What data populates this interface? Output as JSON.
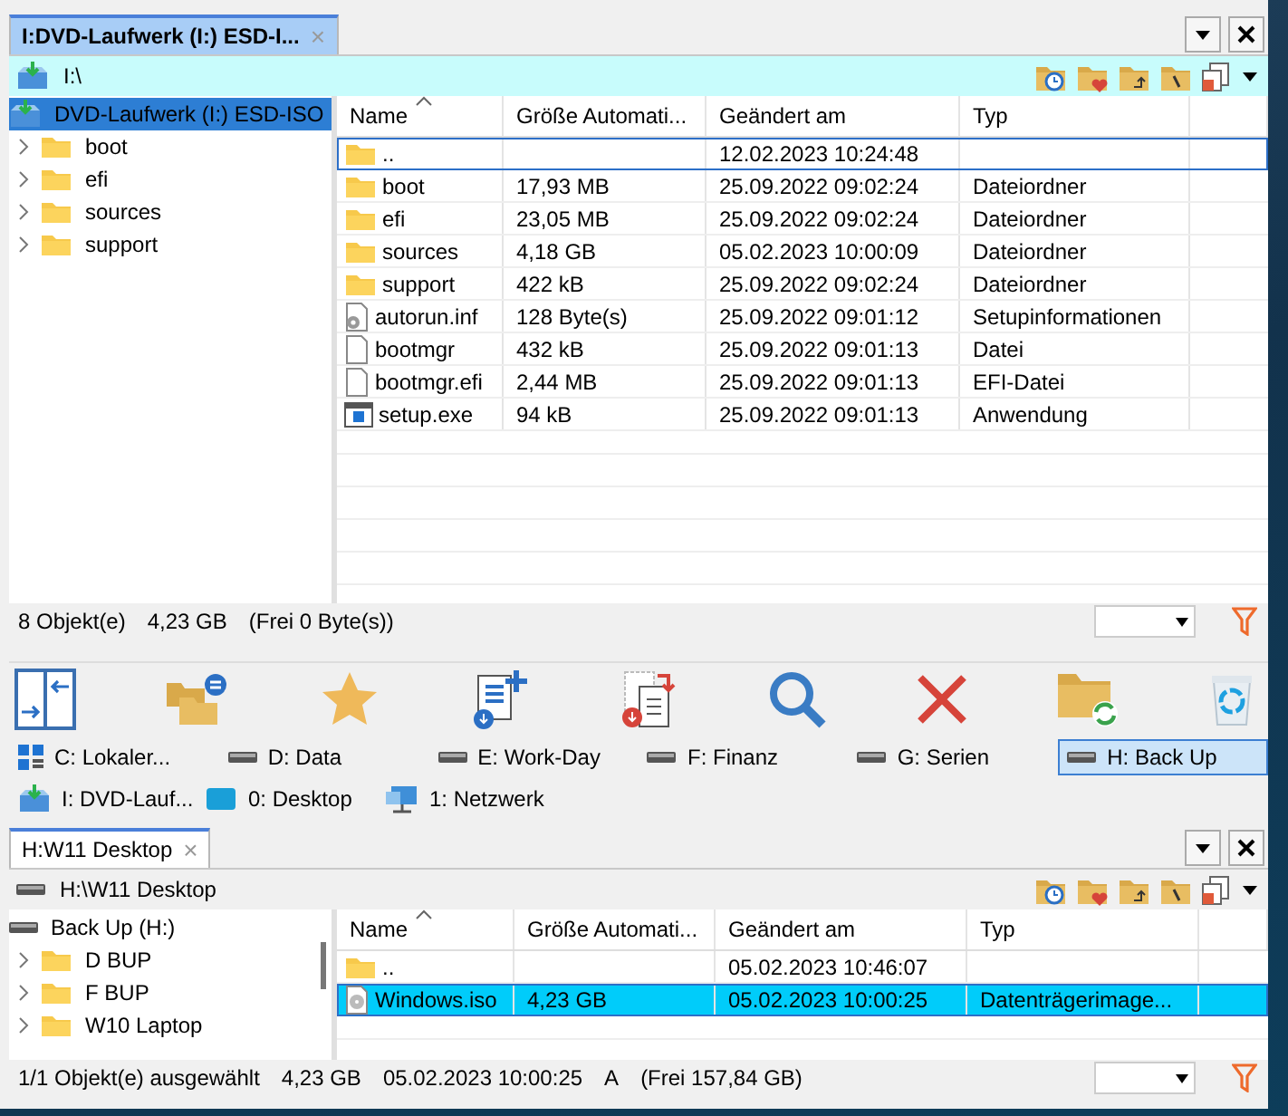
{
  "top_pane": {
    "active": true,
    "tab": {
      "label": "I:DVD-Laufwerk (I:) ESD-I...",
      "close": "×"
    },
    "path": "I:\\",
    "tree": [
      {
        "label": "DVD-Laufwerk (I:) ESD-ISO",
        "kind": "dvd",
        "selected": true,
        "children": [
          {
            "label": "boot",
            "kind": "folder",
            "selected": false
          },
          {
            "label": "efi",
            "kind": "folder",
            "selected": false
          },
          {
            "label": "sources",
            "kind": "folder",
            "selected": false
          },
          {
            "label": "support",
            "kind": "folder",
            "selected": false
          }
        ]
      }
    ],
    "columns": [
      {
        "label": "Name",
        "sorted": true
      },
      {
        "label": "Größe Automati...",
        "sorted": false
      },
      {
        "label": "Geändert am",
        "sorted": false
      },
      {
        "label": "Typ",
        "sorted": false
      }
    ],
    "rows": [
      {
        "name": "..",
        "kind": "folder",
        "modified": "12.02.2023 10:24:48",
        "selected": false,
        "focused": true
      },
      {
        "name": "boot",
        "kind": "folder",
        "size": "17,93 MB",
        "modified": "25.09.2022 09:02:24",
        "type": "Dateiordner",
        "selected": false,
        "focused": false
      },
      {
        "name": "efi",
        "kind": "folder",
        "size": "23,05 MB",
        "modified": "25.09.2022 09:02:24",
        "type": "Dateiordner",
        "selected": false,
        "focused": false
      },
      {
        "name": "sources",
        "kind": "folder",
        "size": "4,18 GB",
        "modified": "05.02.2023 10:00:09",
        "type": "Dateiordner",
        "selected": false,
        "focused": false
      },
      {
        "name": "support",
        "kind": "folder",
        "size": "422 kB",
        "modified": "25.09.2022 09:02:24",
        "type": "Dateiordner",
        "selected": false,
        "focused": false
      },
      {
        "name": "autorun.inf",
        "kind": "settings",
        "size": "128 Byte(s)",
        "modified": "25.09.2022 09:01:12",
        "type": "Setupinformationen",
        "selected": false,
        "focused": false
      },
      {
        "name": "bootmgr",
        "kind": "file",
        "size": "432 kB",
        "modified": "25.09.2022 09:01:13",
        "type": "Datei",
        "selected": false,
        "focused": false
      },
      {
        "name": "bootmgr.efi",
        "kind": "file",
        "size": "2,44 MB",
        "modified": "25.09.2022 09:01:13",
        "type": "EFI-Datei",
        "selected": false,
        "focused": false
      },
      {
        "name": "setup.exe",
        "kind": "app",
        "size": "94 kB",
        "modified": "25.09.2022 09:01:13",
        "type": "Anwendung",
        "selected": false,
        "focused": false
      }
    ],
    "status": [
      "8 Objekt(e)",
      "4,23 GB",
      "(Frei 0 Byte(s))"
    ]
  },
  "drive_bar": [
    [
      {
        "label": "C: Lokaler...",
        "kind": "system",
        "selected": false
      },
      {
        "label": "D: Data",
        "kind": "drive",
        "selected": false
      },
      {
        "label": "E: Work-Day",
        "kind": "drive",
        "selected": false
      },
      {
        "label": "F: Finanz",
        "kind": "drive",
        "selected": false
      },
      {
        "label": "G: Serien",
        "kind": "drive",
        "selected": false
      },
      {
        "label": "H: Back Up",
        "kind": "drive",
        "selected": true
      }
    ],
    [
      {
        "label": "I: DVD-Lauf...",
        "kind": "dvd",
        "selected": false
      },
      {
        "label": "0: Desktop",
        "kind": "desktop",
        "selected": false
      },
      {
        "label": "1: Netzwerk",
        "kind": "network",
        "selected": false
      }
    ]
  ],
  "bottom_pane": {
    "active": false,
    "tab": {
      "label": "H:W11 Desktop",
      "close": "×"
    },
    "path": "H:\\W11 Desktop",
    "tree": [
      {
        "label": "Back Up (H:)",
        "kind": "drive",
        "selected": false,
        "children": [
          {
            "label": "D BUP",
            "kind": "folder",
            "selected": false
          },
          {
            "label": "F BUP",
            "kind": "folder",
            "selected": false
          },
          {
            "label": "W10 Laptop",
            "kind": "folder",
            "selected": false
          }
        ]
      }
    ],
    "columns": [
      {
        "label": "Name",
        "sorted": true
      },
      {
        "label": "Größe Automati...",
        "sorted": false
      },
      {
        "label": "Geändert am",
        "sorted": false
      },
      {
        "label": "Typ",
        "sorted": false
      }
    ],
    "rows": [
      {
        "name": "..",
        "kind": "folder",
        "modified": "05.02.2023 10:46:07",
        "selected": false,
        "focused": false
      },
      {
        "name": "Windows.iso",
        "kind": "disc",
        "size": "4,23 GB",
        "modified": "05.02.2023 10:00:25",
        "type": "Datenträgerimage...",
        "selected": true,
        "focused": true
      }
    ],
    "status": [
      "1/1 Objekt(e) ausgewählt",
      "4,23 GB",
      "05.02.2023 10:00:25",
      "A",
      "(Frei 157,84 GB)"
    ]
  }
}
